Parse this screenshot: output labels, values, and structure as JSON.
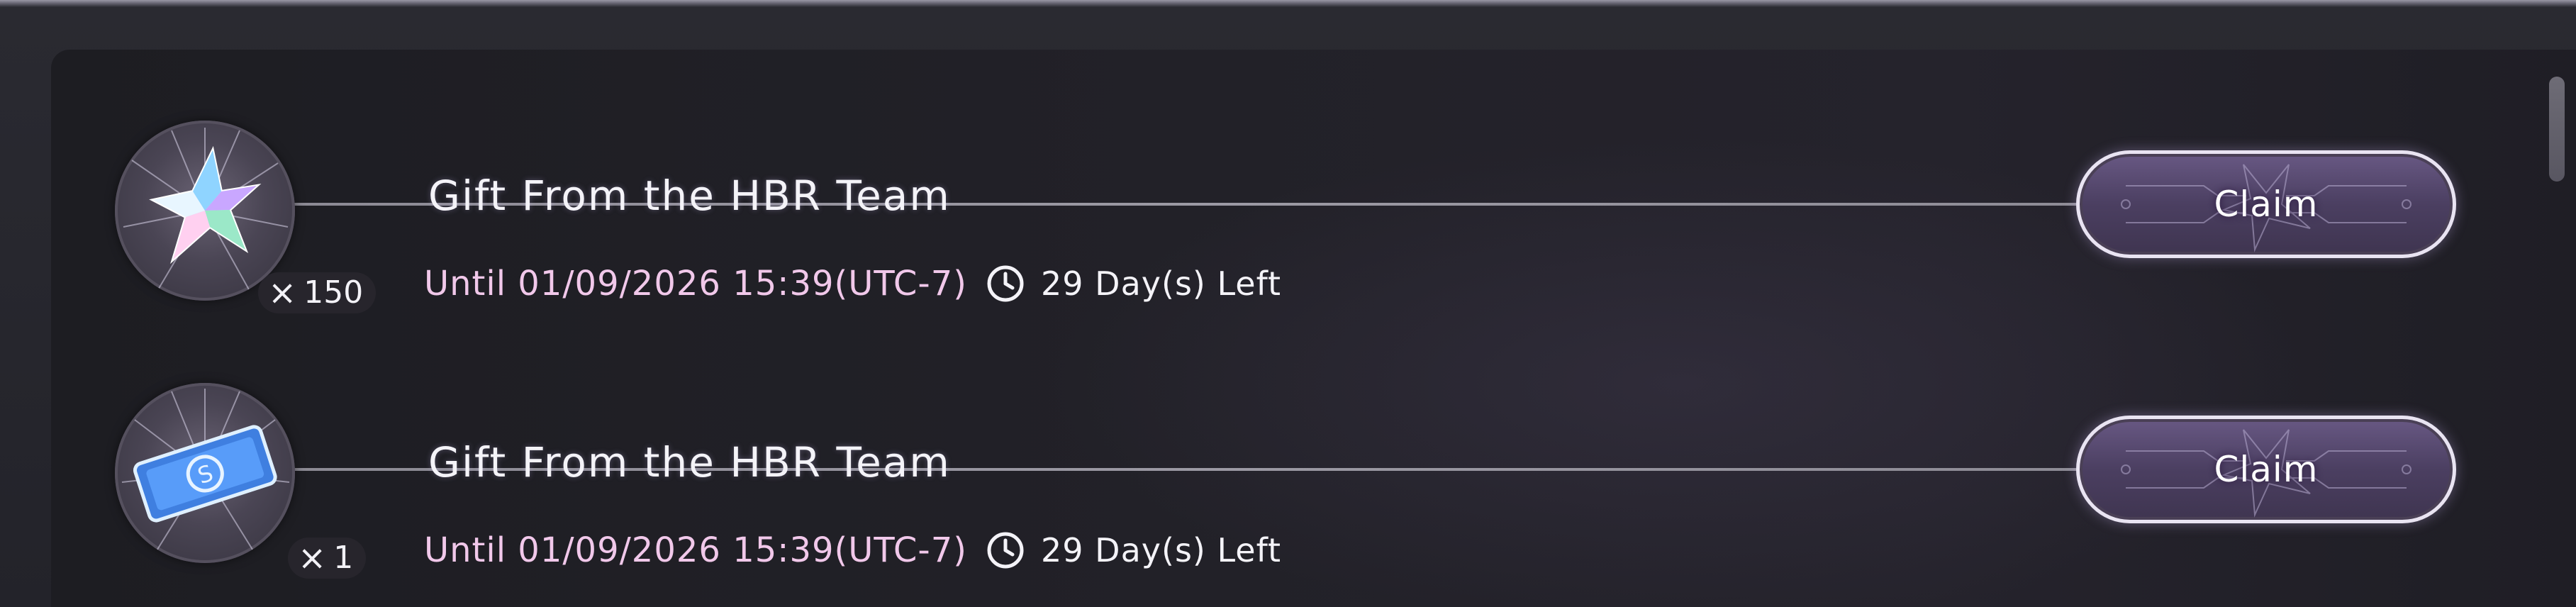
{
  "gifts": [
    {
      "title": "Gift From the HBR Team",
      "item_icon": "crystal-star-icon",
      "quantity": "150",
      "expiry": "Until 01/09/2026 15:39(UTC-7)",
      "days_left": "29 Day(s) Left",
      "claim_label": "Claim"
    },
    {
      "title": "Gift From the HBR Team",
      "item_icon": "ticket-icon",
      "quantity": "1",
      "expiry": "Until 01/09/2026 15:39(UTC-7)",
      "days_left": "29 Day(s) Left",
      "claim_label": "Claim"
    }
  ],
  "colors": {
    "expiry_text": "#f1c8ea",
    "claim_button": "#4b3f61",
    "panel_background": "#222128"
  }
}
